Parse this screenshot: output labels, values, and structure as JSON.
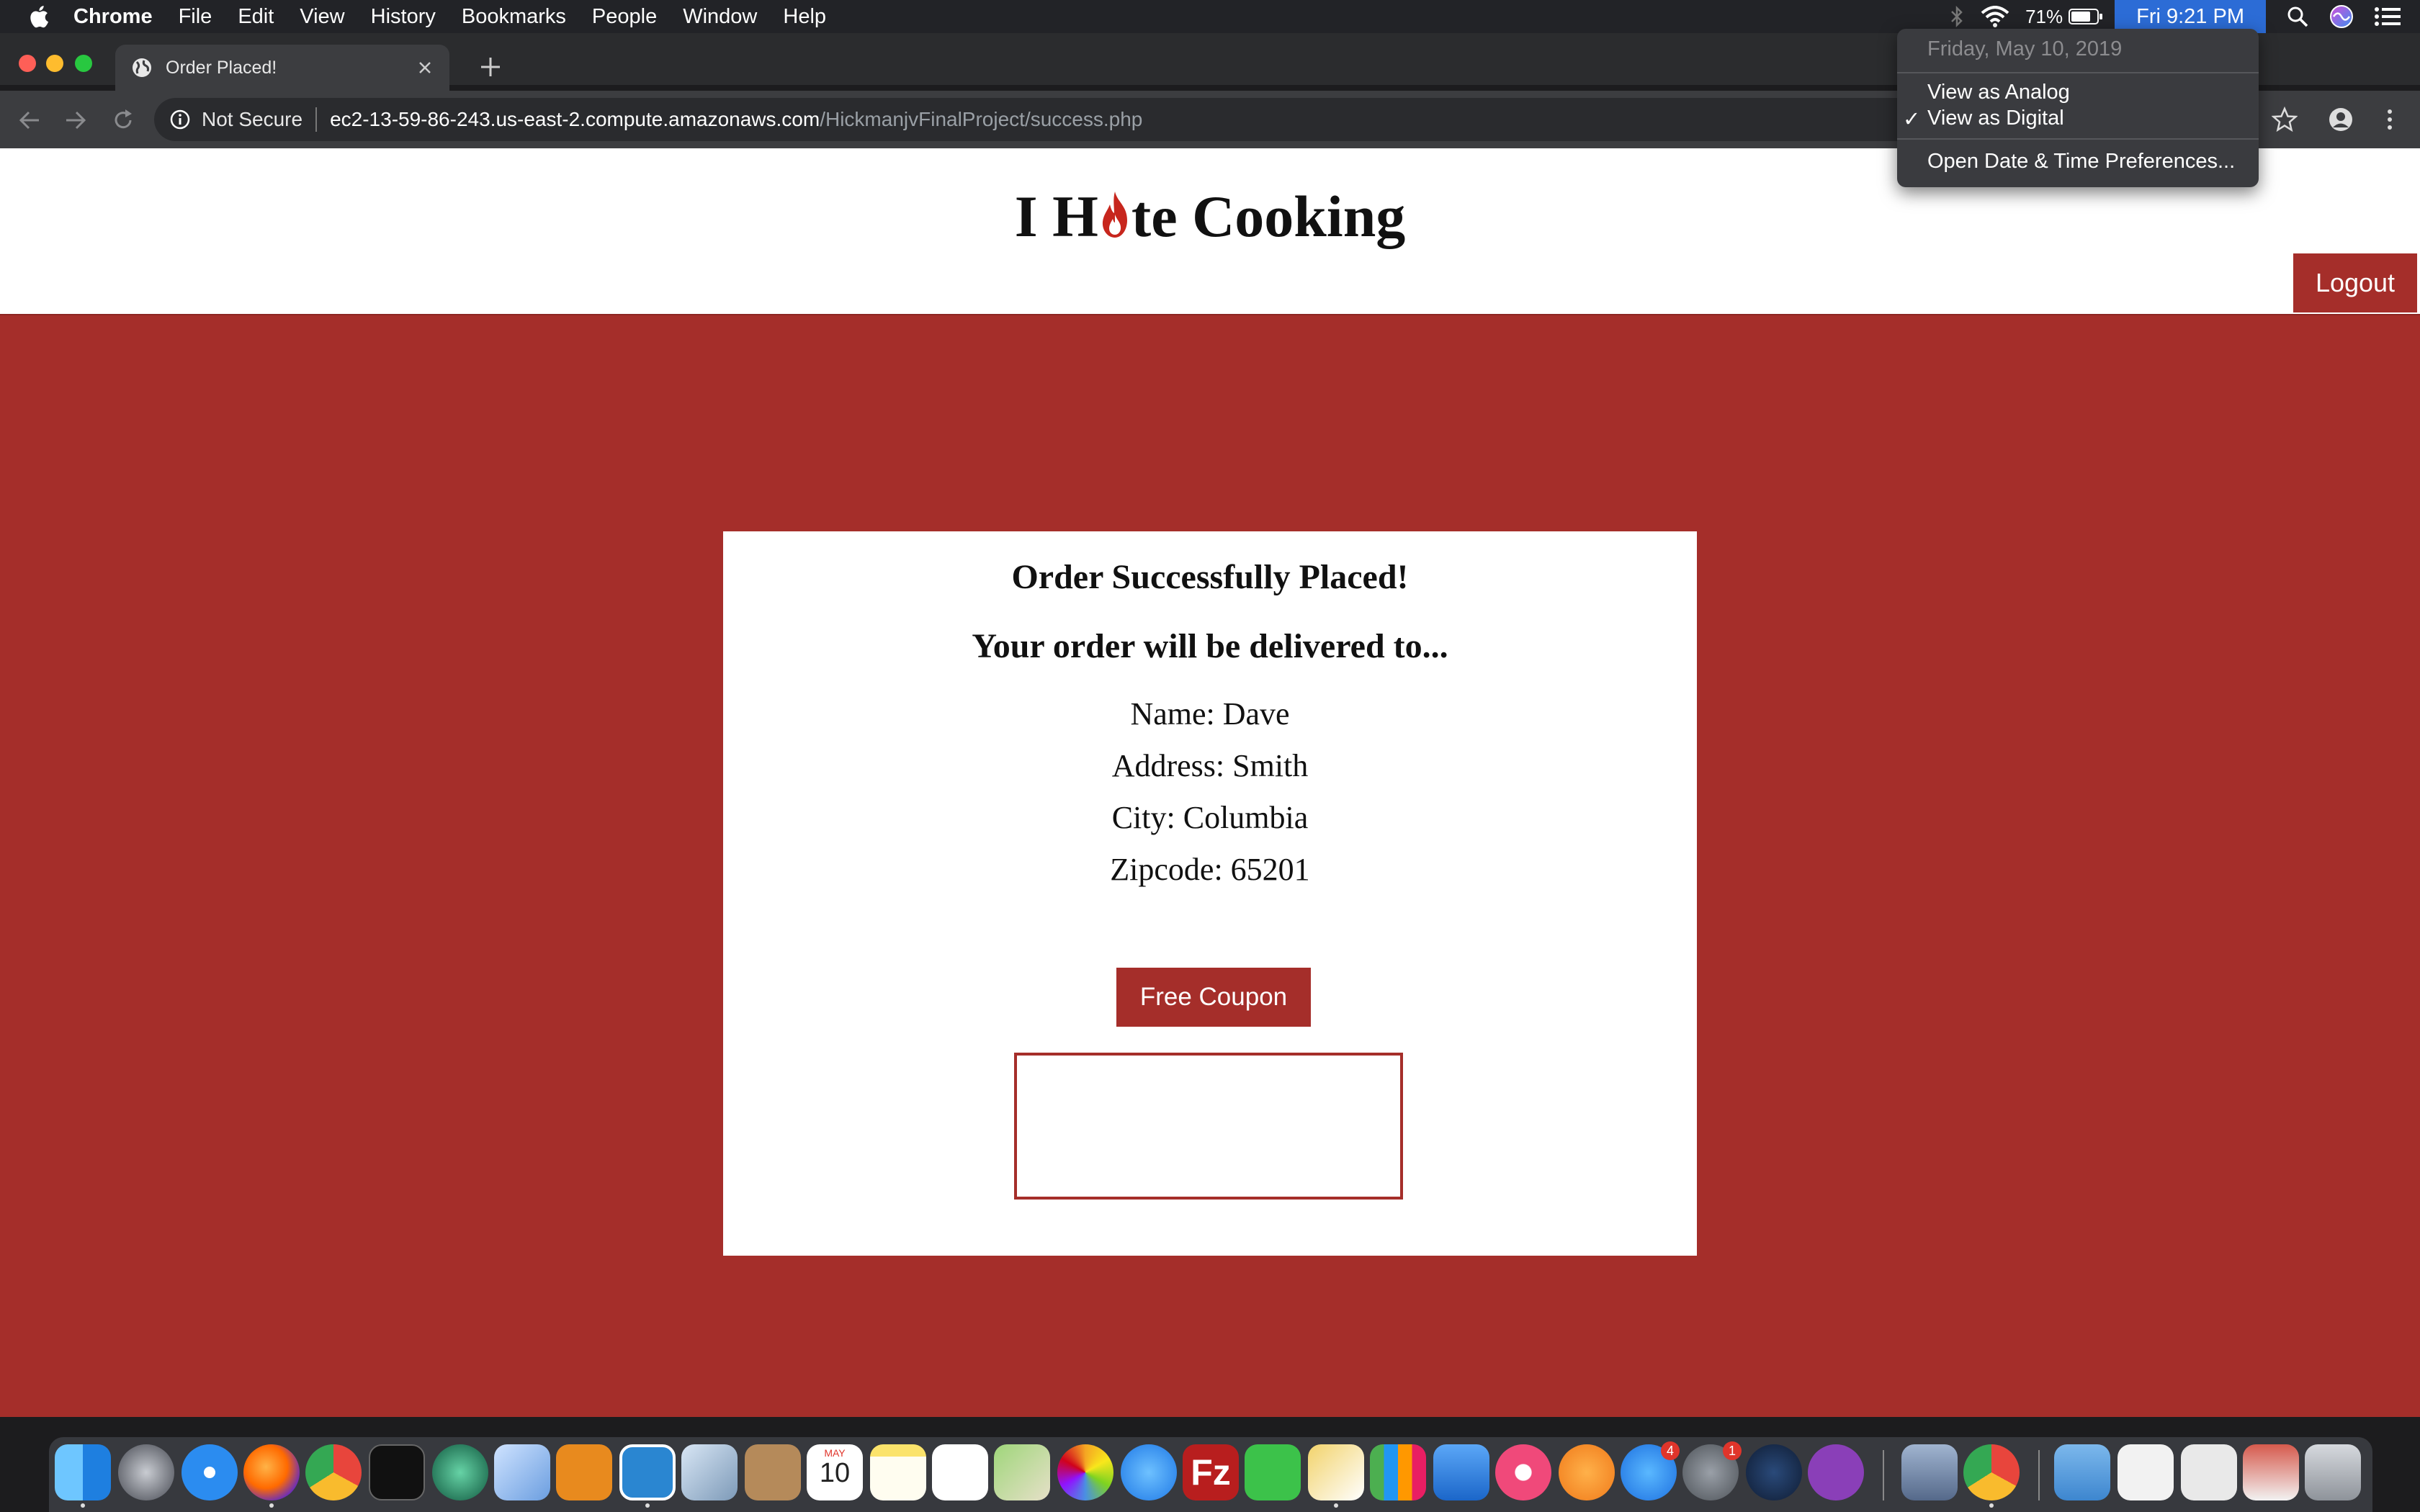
{
  "menubar": {
    "app_name": "Chrome",
    "items": [
      "File",
      "Edit",
      "View",
      "History",
      "Bookmarks",
      "People",
      "Window",
      "Help"
    ],
    "battery": "71%",
    "clock": "Fri 9:21 PM"
  },
  "clock_menu": {
    "date": "Friday, May 10, 2019",
    "view_analog": "View as Analog",
    "view_digital": "View as Digital",
    "check": "✓",
    "preferences": "Open Date & Time Preferences..."
  },
  "browser": {
    "tab_title": "Order Placed!",
    "security_label": "Not Secure",
    "url_host": "ec2-13-59-86-243.us-east-2.compute.amazonaws.com",
    "url_path": "/HickmanjvFinalProject/success.php"
  },
  "site": {
    "title_prefix": "I H",
    "title_suffix": "te Cooking",
    "logout_label": "Logout"
  },
  "order": {
    "heading": "Order Successfully Placed!",
    "subheading": "Your order will be delivered to...",
    "name_line": "Name: Dave",
    "address_line": "Address: Smith",
    "city_line": "City: Columbia",
    "zip_line": "Zipcode: 65201",
    "coupon_button": "Free Coupon"
  },
  "dock": {
    "calendar_month": "MAY",
    "calendar_day": "10",
    "badges": [
      "4",
      "1"
    ]
  },
  "colors": {
    "brand_red": "#a52e2a",
    "menubar_bg": "#222327",
    "clock_highlight": "#2c6cd6"
  }
}
